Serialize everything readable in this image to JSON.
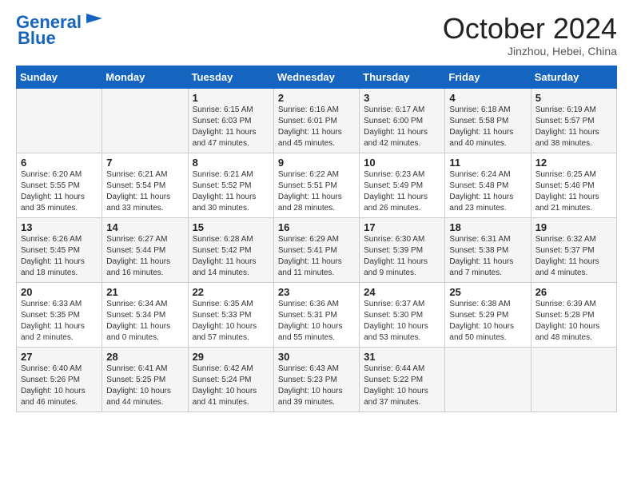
{
  "header": {
    "logo_line1": "General",
    "logo_line2": "Blue",
    "month": "October 2024",
    "location": "Jinzhou, Hebei, China"
  },
  "weekdays": [
    "Sunday",
    "Monday",
    "Tuesday",
    "Wednesday",
    "Thursday",
    "Friday",
    "Saturday"
  ],
  "rows": [
    [
      {
        "day": "",
        "sunrise": "",
        "sunset": "",
        "daylight": ""
      },
      {
        "day": "",
        "sunrise": "",
        "sunset": "",
        "daylight": ""
      },
      {
        "day": "1",
        "sunrise": "Sunrise: 6:15 AM",
        "sunset": "Sunset: 6:03 PM",
        "daylight": "Daylight: 11 hours and 47 minutes."
      },
      {
        "day": "2",
        "sunrise": "Sunrise: 6:16 AM",
        "sunset": "Sunset: 6:01 PM",
        "daylight": "Daylight: 11 hours and 45 minutes."
      },
      {
        "day": "3",
        "sunrise": "Sunrise: 6:17 AM",
        "sunset": "Sunset: 6:00 PM",
        "daylight": "Daylight: 11 hours and 42 minutes."
      },
      {
        "day": "4",
        "sunrise": "Sunrise: 6:18 AM",
        "sunset": "Sunset: 5:58 PM",
        "daylight": "Daylight: 11 hours and 40 minutes."
      },
      {
        "day": "5",
        "sunrise": "Sunrise: 6:19 AM",
        "sunset": "Sunset: 5:57 PM",
        "daylight": "Daylight: 11 hours and 38 minutes."
      }
    ],
    [
      {
        "day": "6",
        "sunrise": "Sunrise: 6:20 AM",
        "sunset": "Sunset: 5:55 PM",
        "daylight": "Daylight: 11 hours and 35 minutes."
      },
      {
        "day": "7",
        "sunrise": "Sunrise: 6:21 AM",
        "sunset": "Sunset: 5:54 PM",
        "daylight": "Daylight: 11 hours and 33 minutes."
      },
      {
        "day": "8",
        "sunrise": "Sunrise: 6:21 AM",
        "sunset": "Sunset: 5:52 PM",
        "daylight": "Daylight: 11 hours and 30 minutes."
      },
      {
        "day": "9",
        "sunrise": "Sunrise: 6:22 AM",
        "sunset": "Sunset: 5:51 PM",
        "daylight": "Daylight: 11 hours and 28 minutes."
      },
      {
        "day": "10",
        "sunrise": "Sunrise: 6:23 AM",
        "sunset": "Sunset: 5:49 PM",
        "daylight": "Daylight: 11 hours and 26 minutes."
      },
      {
        "day": "11",
        "sunrise": "Sunrise: 6:24 AM",
        "sunset": "Sunset: 5:48 PM",
        "daylight": "Daylight: 11 hours and 23 minutes."
      },
      {
        "day": "12",
        "sunrise": "Sunrise: 6:25 AM",
        "sunset": "Sunset: 5:46 PM",
        "daylight": "Daylight: 11 hours and 21 minutes."
      }
    ],
    [
      {
        "day": "13",
        "sunrise": "Sunrise: 6:26 AM",
        "sunset": "Sunset: 5:45 PM",
        "daylight": "Daylight: 11 hours and 18 minutes."
      },
      {
        "day": "14",
        "sunrise": "Sunrise: 6:27 AM",
        "sunset": "Sunset: 5:44 PM",
        "daylight": "Daylight: 11 hours and 16 minutes."
      },
      {
        "day": "15",
        "sunrise": "Sunrise: 6:28 AM",
        "sunset": "Sunset: 5:42 PM",
        "daylight": "Daylight: 11 hours and 14 minutes."
      },
      {
        "day": "16",
        "sunrise": "Sunrise: 6:29 AM",
        "sunset": "Sunset: 5:41 PM",
        "daylight": "Daylight: 11 hours and 11 minutes."
      },
      {
        "day": "17",
        "sunrise": "Sunrise: 6:30 AM",
        "sunset": "Sunset: 5:39 PM",
        "daylight": "Daylight: 11 hours and 9 minutes."
      },
      {
        "day": "18",
        "sunrise": "Sunrise: 6:31 AM",
        "sunset": "Sunset: 5:38 PM",
        "daylight": "Daylight: 11 hours and 7 minutes."
      },
      {
        "day": "19",
        "sunrise": "Sunrise: 6:32 AM",
        "sunset": "Sunset: 5:37 PM",
        "daylight": "Daylight: 11 hours and 4 minutes."
      }
    ],
    [
      {
        "day": "20",
        "sunrise": "Sunrise: 6:33 AM",
        "sunset": "Sunset: 5:35 PM",
        "daylight": "Daylight: 11 hours and 2 minutes."
      },
      {
        "day": "21",
        "sunrise": "Sunrise: 6:34 AM",
        "sunset": "Sunset: 5:34 PM",
        "daylight": "Daylight: 11 hours and 0 minutes."
      },
      {
        "day": "22",
        "sunrise": "Sunrise: 6:35 AM",
        "sunset": "Sunset: 5:33 PM",
        "daylight": "Daylight: 10 hours and 57 minutes."
      },
      {
        "day": "23",
        "sunrise": "Sunrise: 6:36 AM",
        "sunset": "Sunset: 5:31 PM",
        "daylight": "Daylight: 10 hours and 55 minutes."
      },
      {
        "day": "24",
        "sunrise": "Sunrise: 6:37 AM",
        "sunset": "Sunset: 5:30 PM",
        "daylight": "Daylight: 10 hours and 53 minutes."
      },
      {
        "day": "25",
        "sunrise": "Sunrise: 6:38 AM",
        "sunset": "Sunset: 5:29 PM",
        "daylight": "Daylight: 10 hours and 50 minutes."
      },
      {
        "day": "26",
        "sunrise": "Sunrise: 6:39 AM",
        "sunset": "Sunset: 5:28 PM",
        "daylight": "Daylight: 10 hours and 48 minutes."
      }
    ],
    [
      {
        "day": "27",
        "sunrise": "Sunrise: 6:40 AM",
        "sunset": "Sunset: 5:26 PM",
        "daylight": "Daylight: 10 hours and 46 minutes."
      },
      {
        "day": "28",
        "sunrise": "Sunrise: 6:41 AM",
        "sunset": "Sunset: 5:25 PM",
        "daylight": "Daylight: 10 hours and 44 minutes."
      },
      {
        "day": "29",
        "sunrise": "Sunrise: 6:42 AM",
        "sunset": "Sunset: 5:24 PM",
        "daylight": "Daylight: 10 hours and 41 minutes."
      },
      {
        "day": "30",
        "sunrise": "Sunrise: 6:43 AM",
        "sunset": "Sunset: 5:23 PM",
        "daylight": "Daylight: 10 hours and 39 minutes."
      },
      {
        "day": "31",
        "sunrise": "Sunrise: 6:44 AM",
        "sunset": "Sunset: 5:22 PM",
        "daylight": "Daylight: 10 hours and 37 minutes."
      },
      {
        "day": "",
        "sunrise": "",
        "sunset": "",
        "daylight": ""
      },
      {
        "day": "",
        "sunrise": "",
        "sunset": "",
        "daylight": ""
      }
    ]
  ]
}
